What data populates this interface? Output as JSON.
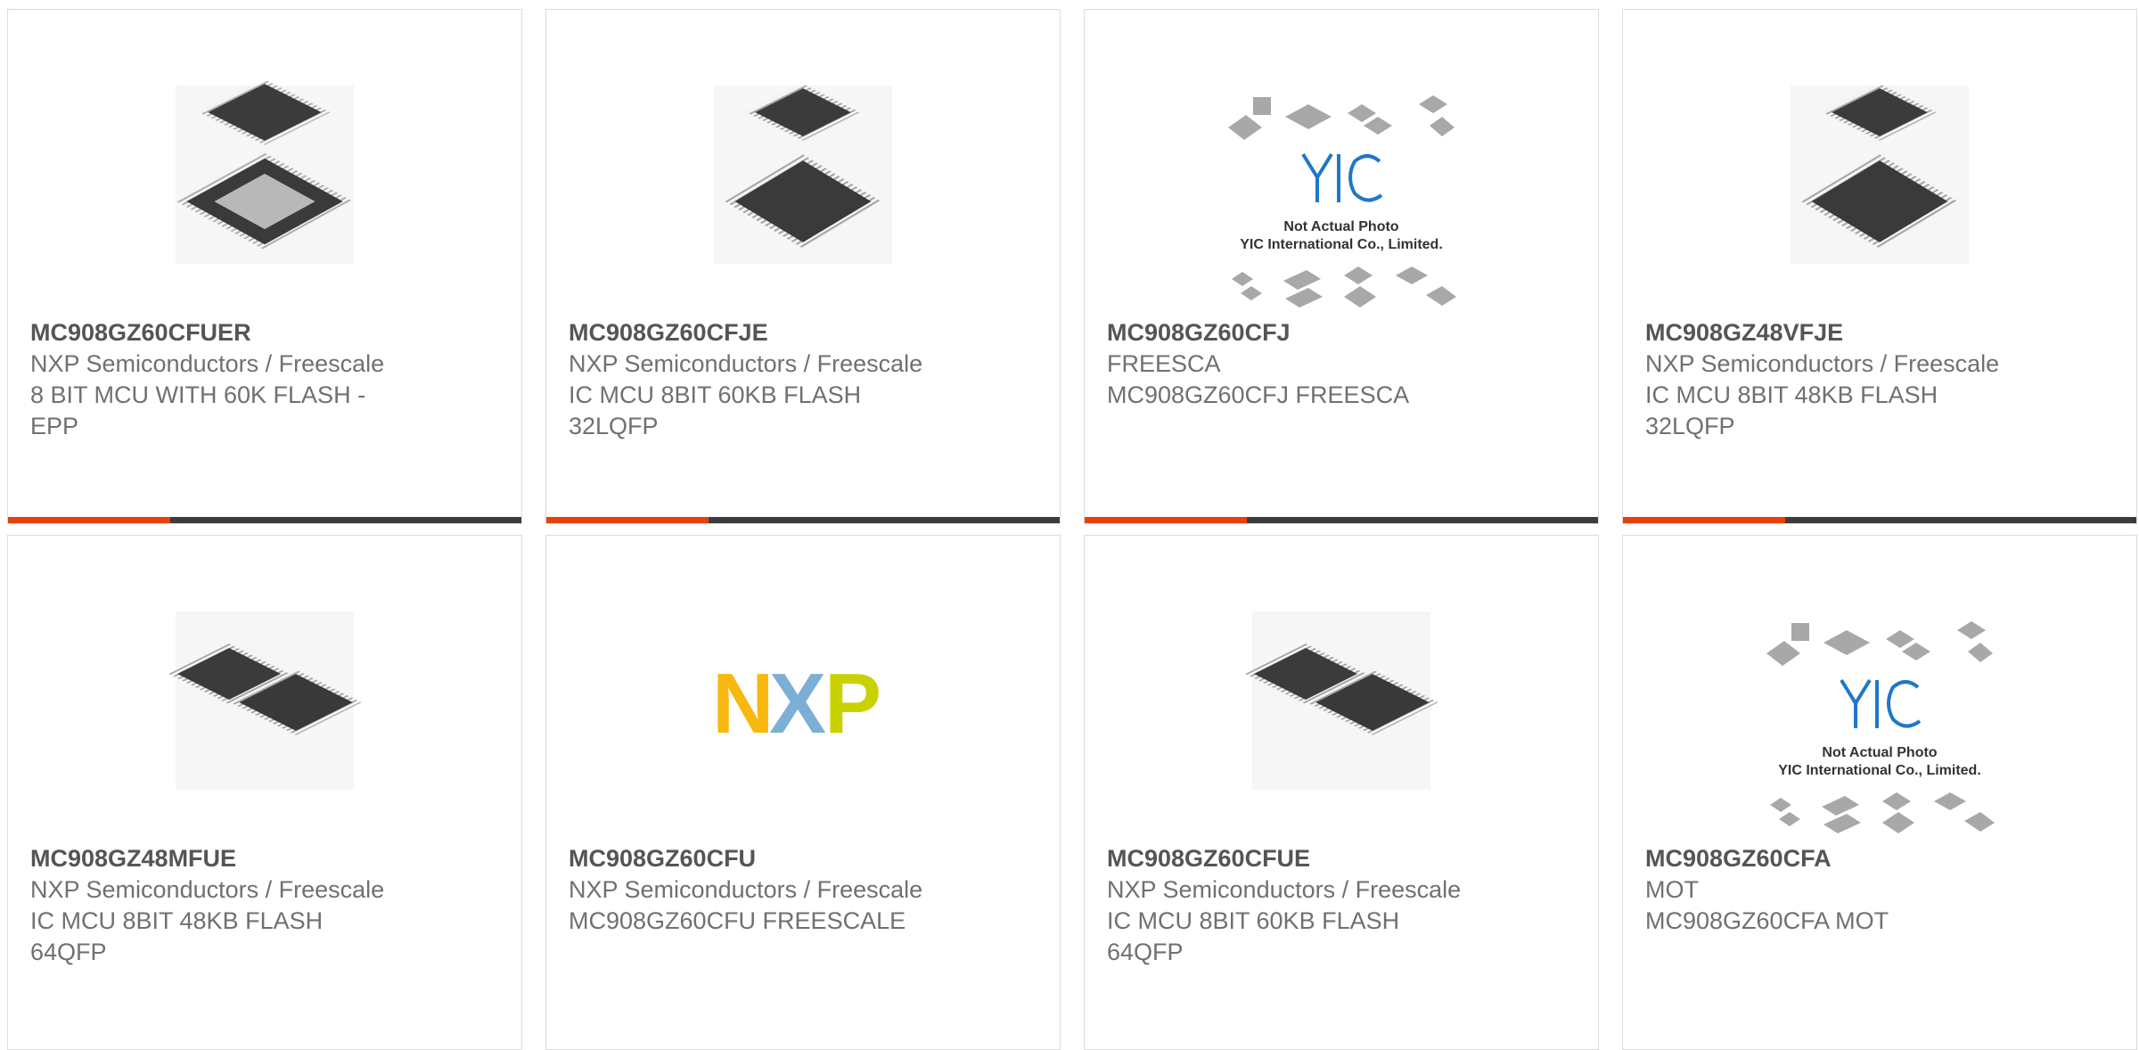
{
  "products": [
    {
      "part_number": "MC908GZ60CFUER",
      "brand": "NXP Semiconductors / Freescale",
      "description": "8 BIT MCU WITH 60K FLASH -\nEPP",
      "image": "qfp-chip-pair-icon"
    },
    {
      "part_number": "MC908GZ60CFJE",
      "brand": "NXP Semiconductors / Freescale",
      "description": "IC MCU 8BIT 60KB FLASH\n32LQFP",
      "image": "lqfp-chip-pair-icon"
    },
    {
      "part_number": "MC908GZ60CFJ",
      "brand": "FREESCA",
      "description": "MC908GZ60CFJ FREESCA",
      "image": "yic-placeholder-image"
    },
    {
      "part_number": "MC908GZ48VFJE",
      "brand": "NXP Semiconductors / Freescale",
      "description": "IC MCU 8BIT 48KB FLASH\n32LQFP",
      "image": "lqfp-chip-pair-icon"
    },
    {
      "part_number": "MC908GZ48MFUE",
      "brand": "NXP Semiconductors / Freescale",
      "description": "IC MCU 8BIT 48KB FLASH\n64QFP",
      "image": "qfp-chip-side-icon"
    },
    {
      "part_number": "MC908GZ60CFU",
      "brand": "NXP Semiconductors / Freescale",
      "description": "MC908GZ60CFU FREESCALE",
      "image": "nxp-logo"
    },
    {
      "part_number": "MC908GZ60CFUE",
      "brand": "NXP Semiconductors / Freescale",
      "description": "IC MCU 8BIT 60KB FLASH\n64QFP",
      "image": "qfp-chip-side-icon"
    },
    {
      "part_number": "MC908GZ60CFA",
      "brand": "MOT",
      "description": "MC908GZ60CFA MOT",
      "image": "yic-placeholder-image"
    }
  ],
  "placeholder": {
    "logo_text": "YIC",
    "line1": "Not Actual Photo",
    "line2": "YIC International Co., Limited."
  },
  "nxp_logo": {
    "text": "NXP"
  },
  "colors": {
    "accent": "#e8400c",
    "bar": "#3c3c3c",
    "part_number": "#555555",
    "text": "#707070",
    "border": "#dcdcdc",
    "nxp_n": "#f9b80f",
    "nxp_x": "#7bafd4",
    "nxp_p": "#c9d200"
  }
}
